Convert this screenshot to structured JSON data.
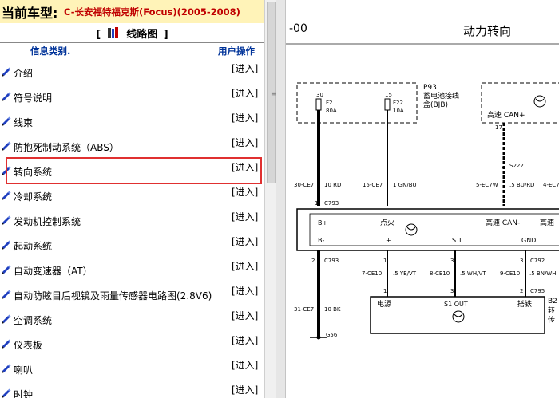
{
  "header": {
    "vehicle_label": "当前车型:",
    "vehicle_name": "C-长安福特福克斯(Focus)(2005-2008)"
  },
  "section": {
    "bracket_left": "[",
    "title": "线路图",
    "bracket_right": "]"
  },
  "columns": {
    "category": "信息类别.",
    "action": "用户操作"
  },
  "categories": [
    {
      "label": "介绍",
      "action": "[进入]"
    },
    {
      "label": "符号说明",
      "action": "[进入]"
    },
    {
      "label": "线束",
      "action": "[进入]"
    },
    {
      "label": "防抱死制动系统（ABS）",
      "action": "[进入]"
    },
    {
      "label": "转向系统",
      "action": "[进入]",
      "selected": true
    },
    {
      "label": "冷却系统",
      "action": "[进入]"
    },
    {
      "label": "发动机控制系统",
      "action": "[进入]"
    },
    {
      "label": "起动系统",
      "action": "[进入]"
    },
    {
      "label": "自动变速器（AT）",
      "action": "[进入]"
    },
    {
      "label": "自动防眩目后视镜及雨量传感器电路图(2.8V6)",
      "action": "[进入]"
    },
    {
      "label": "空调系统",
      "action": "[进入]"
    },
    {
      "label": "仪表板",
      "action": "[进入]"
    },
    {
      "label": "喇叭",
      "action": "[进入]"
    },
    {
      "label": "时钟",
      "action": "[进入]"
    }
  ],
  "colors": {
    "highlight": "#e03030",
    "vehicle_name": "#c00000",
    "header_bg": "#fff3b8",
    "column_header": "#003399",
    "icon_blue": "#1f3fbf"
  },
  "diagram": {
    "page_ref": "-00",
    "title": "动力转向",
    "p93_code": "P93",
    "p93_name_1": "蓄电池接线",
    "p93_name_2": "盒(BJB)",
    "pin30": "30",
    "pin15": "15",
    "f2": "F2",
    "f2_amp": "80A",
    "f22": "F22",
    "f22_amp": "10A",
    "can_plus_top": "高速 CAN+",
    "pin17": "17",
    "s222": "S222",
    "wire_30ce7": "30-CE7",
    "wire_10rd": "10 RD",
    "wire_15ce7": "15-CE7",
    "wire_1gnbu": "1 GN/BU",
    "wire_5ec7w": "5-EC7W",
    "wire_5burd": ".5 BU/RD",
    "wire_4ec7_partial": "4-EC7",
    "pin1": "1",
    "c793_top": "C793",
    "bplus": "B+",
    "ignition": "点火",
    "can_minus": "高速 CAN-",
    "can_right_partial": "高速",
    "bminus": "B-",
    "plus_sign": "+",
    "s1": "S 1",
    "gnd": "GND",
    "pin2": "2",
    "c793_bot": "C793",
    "pin1b": "1",
    "pin3": "3",
    "pin3b": "3",
    "c792": "C792",
    "wire_7ce10": "7-CE10",
    "wire_5yevt": ".5 YE/VT",
    "wire_8ce10": "8-CE10",
    "wire_5whvt": ".5 WH/VT",
    "wire_9ce10": "9-CE10",
    "wire_5bnwh": ".5 BN/WH",
    "pin1c": "1",
    "pin3c": "3",
    "pin2c": "2",
    "c795": "C795",
    "wire_31ce7": "31-CE7",
    "wire_10bk": "10 BK",
    "power_label": "电源",
    "s1out": "S1 OUT",
    "ground_label": "搭铁",
    "b2_partial": "B2",
    "b2_line2": "转",
    "b2_line3": "传",
    "g56": "G56"
  }
}
